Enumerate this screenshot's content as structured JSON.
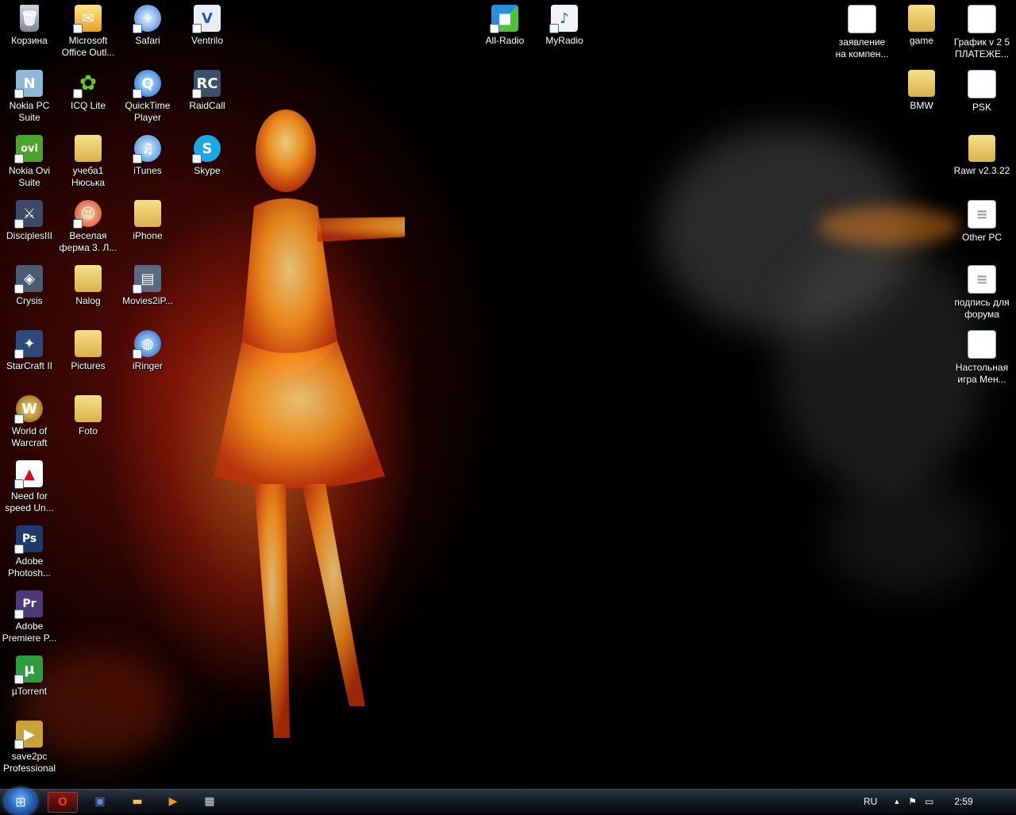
{
  "desktop_icons": {
    "recycle_bin": "Корзина",
    "outlook": "Microsoft Office Outl...",
    "safari": "Safari",
    "ventrilo": "Ventrilo",
    "all_radio": "All-Radio",
    "myradio": "MyRadio",
    "zayavlenie": "заявление на компен...",
    "game": "game",
    "grafik": "График v 2 5 ПЛАТЕЖЕ...",
    "nokia_pc_suite": "Nokia PC Suite",
    "icq_lite": "ICQ Lite",
    "quicktime": "QuickTime Player",
    "raidcall": "RaidCall",
    "bmw": "BMW",
    "psk": "PSK",
    "nokia_ovi": "Nokia Ovi Suite",
    "ucheba": "учеба1 Нюська",
    "itunes": "iTunes",
    "skype": "Skype",
    "rawr": "Rawr v2.3.22",
    "disciples": "DisciplesIII",
    "vesela_ferma": "Веселая ферма 3. Л...",
    "iphone": "iPhone",
    "other_pc": "Other PC",
    "crysis": "Crysis",
    "nalog": "Nalog",
    "movies2ip": "Movies2iP...",
    "podpis": "подпись для форума",
    "starcraft": "StarCraft II",
    "pictures": "Pictures",
    "iringer": "iRinger",
    "nastolnaya": "Настольная игра Мен...",
    "wow": "World of Warcraft",
    "foto": "Foto",
    "nfs": "Need for speed Un...",
    "photoshop": "Adobe Photosh...",
    "premiere": "Adobe Premiere P...",
    "utorrent": "µTorrent",
    "save2pc": "save2pc Professional"
  },
  "taskbar": {
    "language": "RU",
    "clock": "2:59"
  },
  "colors": {
    "taskbar_bg": "#10161d",
    "desktop_bg": "#000000",
    "flame": "#ff8c1a"
  }
}
